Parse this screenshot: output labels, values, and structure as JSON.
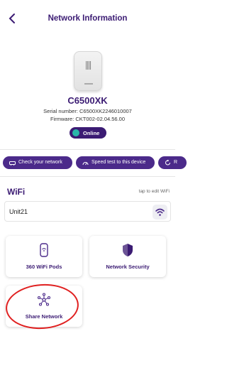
{
  "header": {
    "title": "Network Information"
  },
  "device": {
    "model": "C6500XK",
    "serial": "Serial number: C6500XK2246010007",
    "firmware": "Firmware: CKT002-02.04.56.00",
    "status": "Online",
    "image_alt": "router-image"
  },
  "actions": [
    {
      "label": "Check your network",
      "icon": "car-icon"
    },
    {
      "label": "Speed test to this device",
      "icon": "speedometer-icon"
    },
    {
      "label": "R",
      "icon": "restart-icon"
    }
  ],
  "wifi": {
    "title": "WiFi",
    "hint": "tap to edit WiFi",
    "ssid": "Unit21",
    "ssid_icon": "wifi-icon"
  },
  "cards": [
    {
      "label": "360 WiFi Pods",
      "icon": "pod-icon"
    },
    {
      "label": "Network Security",
      "icon": "shield-icon"
    },
    {
      "label": "Share Network",
      "icon": "share-network-icon"
    }
  ],
  "colors": {
    "primary": "#3b1b73",
    "button": "#4b2a8a",
    "online_dot": "#2ab7a9",
    "annotation": "#e02020"
  }
}
